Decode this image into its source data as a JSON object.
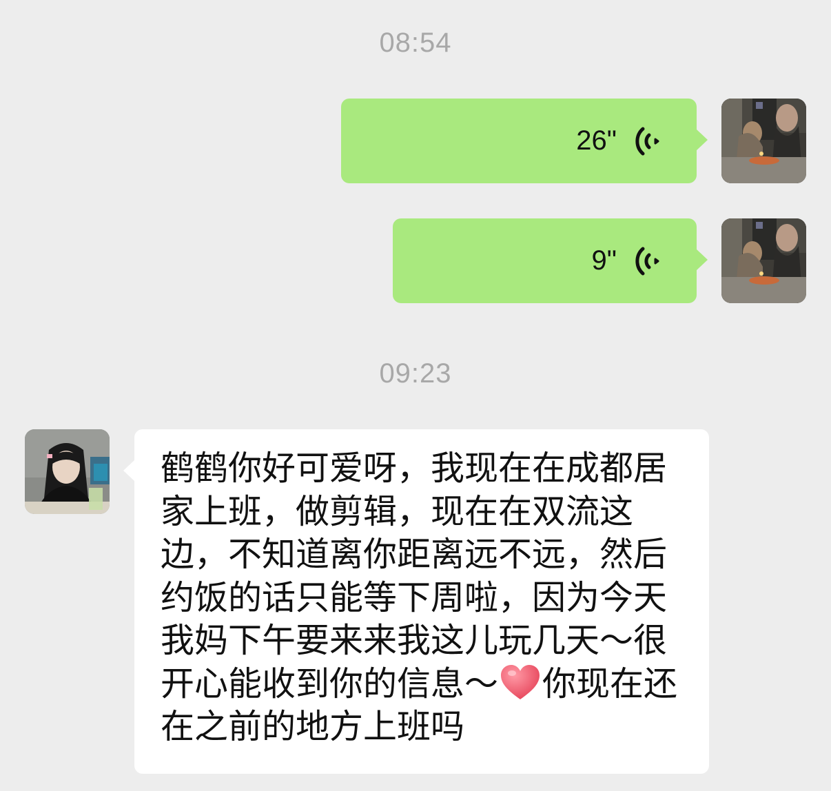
{
  "timestamps": [
    "08:54",
    "09:23"
  ],
  "messages": {
    "voice1": {
      "duration": "26\"",
      "icon": "voice-wave-icon"
    },
    "voice2": {
      "duration": "9\"",
      "icon": "voice-wave-icon"
    },
    "text1": {
      "part1": "鹤鹤你好可爱呀，我现在在成都居家上班，做剪辑，现在在双流这边，不知道离你距离远不远，然后约饭的话只能等下周啦，因为今天我妈下午要来来我这儿玩几天～很开心能收到你的信息～",
      "emoji": "heart-icon",
      "part2": "你现在还在之前的地方上班吗"
    }
  },
  "colors": {
    "background": "#ededed",
    "sent_bubble": "#a9e97e",
    "received_bubble": "#ffffff",
    "timestamp": "#a8a8a8",
    "heart": "#f06a7a"
  }
}
